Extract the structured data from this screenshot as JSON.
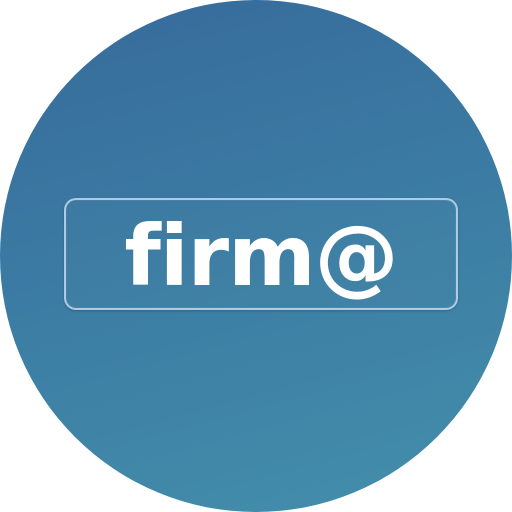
{
  "logo": {
    "text": "firm@"
  },
  "colors": {
    "circle_top": "#376a9b",
    "circle_bottom": "#448fab",
    "text": "#ffffff"
  }
}
